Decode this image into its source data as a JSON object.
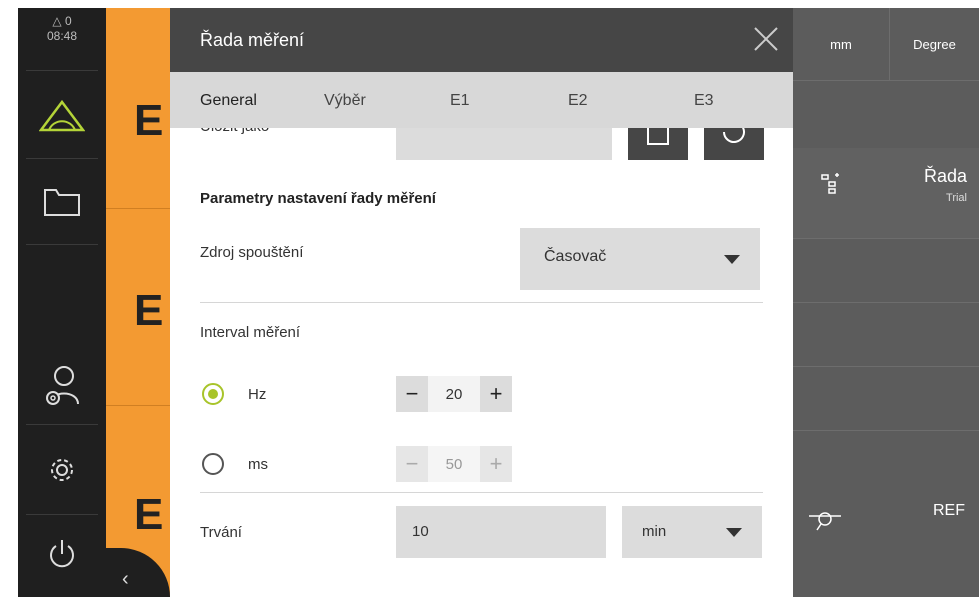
{
  "status": {
    "warnings": "0",
    "time": "08:48"
  },
  "sidebar": {
    "items": [
      {
        "icon": "measure-triangle-icon"
      },
      {
        "icon": "folder-icon"
      },
      {
        "icon": "user-settings-icon"
      },
      {
        "icon": "settings-icon"
      },
      {
        "icon": "power-icon"
      }
    ]
  },
  "background": {
    "labels": [
      "E",
      "E",
      "E"
    ],
    "units": {
      "length": "mm",
      "angle": "Degree"
    },
    "series_panel": {
      "title": "Řada",
      "subtitle": "Trial"
    },
    "ref_label": "REF"
  },
  "dialog": {
    "title": "Řada měření",
    "tabs": [
      "General",
      "Výběr",
      "E1",
      "E2",
      "E3"
    ],
    "save_as_label": "Uložit jako",
    "section_title": "Parametry nastavení řady měření",
    "trigger_label": "Zdroj spouštění",
    "trigger_value": "Časovač",
    "interval_label": "Interval měření",
    "hz": {
      "label": "Hz",
      "value": "20",
      "selected": true
    },
    "ms": {
      "label": "ms",
      "value": "50",
      "selected": false
    },
    "duration_label": "Trvání",
    "duration_value": "10",
    "duration_unit": "min"
  },
  "colors": {
    "accent": "#f39a32",
    "radio": "#a8c42a",
    "header": "#464646"
  }
}
